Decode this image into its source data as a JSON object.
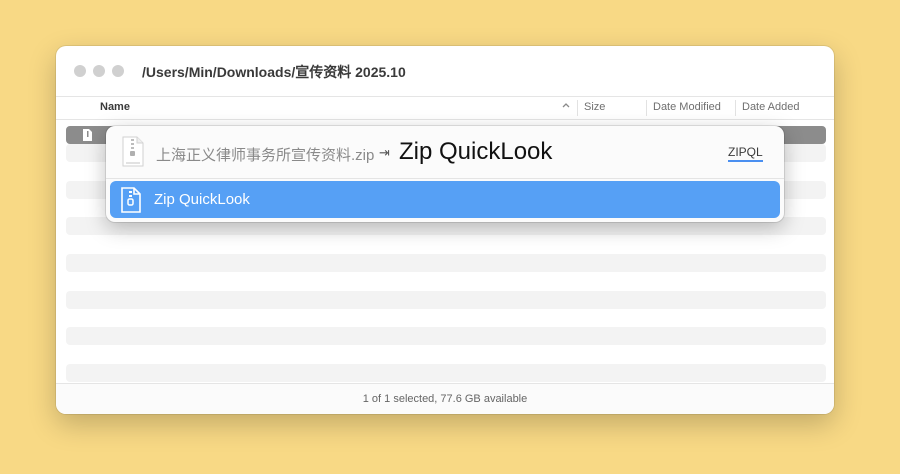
{
  "window": {
    "title": "/Users/Min/Downloads/宣传资料 2025.10",
    "traffic_lights": [
      "close",
      "minimize",
      "zoom"
    ]
  },
  "columns": {
    "name": "Name",
    "sort_indicator": "chevron-up",
    "size": "Size",
    "date_modified": "Date Modified",
    "date_added": "Date Added"
  },
  "status_bar": {
    "text": "1 of 1 selected, 77.6 GB available"
  },
  "popup": {
    "source_icon": "zip-file-icon",
    "source_name": "上海正义律师事务所宣传资料.zip",
    "arrow": "⇥",
    "target_name": "Zip QuickLook",
    "shortcut": "ZIPQL",
    "results": [
      {
        "icon": "zip-document-icon",
        "label": "Zip QuickLook",
        "selected": true
      }
    ]
  },
  "colors": {
    "background": "#f8d985",
    "selection": "#56a0f5",
    "selected_row": "#8c8c8c"
  }
}
